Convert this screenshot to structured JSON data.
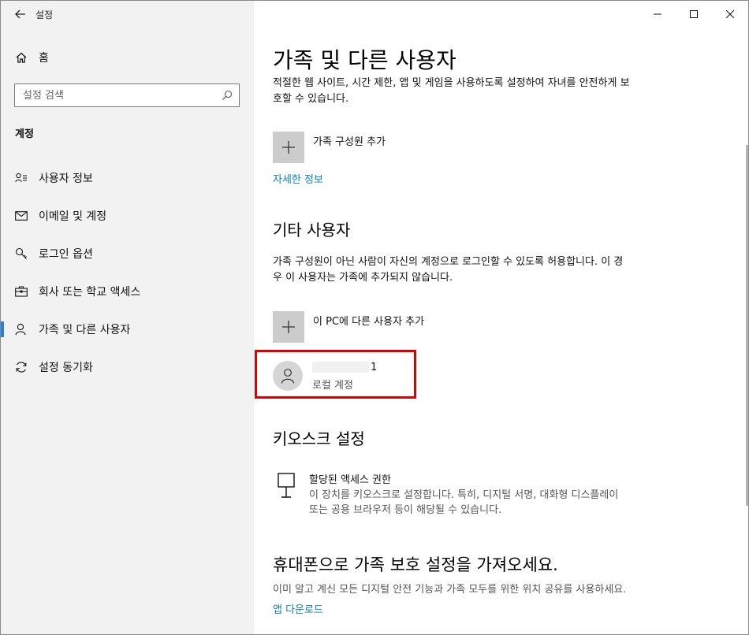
{
  "window": {
    "title": "설정",
    "controls": {
      "minimize": "—",
      "maximize": "☐",
      "close": "✕"
    }
  },
  "sidebar": {
    "home_label": "홈",
    "search_placeholder": "설정 검색",
    "section_label": "계정",
    "items": [
      {
        "label": "사용자 정보",
        "icon": "user-info-icon"
      },
      {
        "label": "이메일 및 계정",
        "icon": "mail-icon"
      },
      {
        "label": "로그인 옵션",
        "icon": "key-icon"
      },
      {
        "label": "회사 또는 학교 액세스",
        "icon": "briefcase-icon"
      },
      {
        "label": "가족 및 다른 사용자",
        "icon": "person-icon",
        "active": true
      },
      {
        "label": "설정 동기화",
        "icon": "sync-icon"
      }
    ]
  },
  "main": {
    "title": "가족 및 다른 사용자",
    "family_desc": "적절한 웹 사이트, 시간 제한, 앱 및 게임을 사용하도록 설정하여 자녀를 안전하게 보호할 수 있습니다.",
    "add_family_label": "가족 구성원 추가",
    "more_info_link": "자세한 정보",
    "other_users_heading": "기타 사용자",
    "other_users_desc": "가족 구성원이 아닌 사람이 자신의 계정으로 로그인할 수 있도록 허용합니다. 이 경우 이 사용자는 가족에 추가되지 않습니다.",
    "add_other_label": "이 PC에 다른 사용자 추가",
    "user": {
      "name_suffix": "1",
      "type": "로컬 계정"
    },
    "kiosk_heading": "키오스크 설정",
    "kiosk_title": "할당된 액세스 권한",
    "kiosk_desc": "이 장치를 키오스크로 설정합니다. 특히, 디지털 서명, 대화형 디스플레이 또는 공용 브라우저 등이 해당될 수 있습니다.",
    "phone_heading": "휴대폰으로 가족 보호 설정을 가져오세요.",
    "phone_desc": "이미 알고 계신 모든 디지털 안전 기능과 가족 모두를 위한 위치 공유를 사용하세요.",
    "app_download_link": "앱 다운로드"
  },
  "colors": {
    "accent": "#0a7fc0",
    "active_indicator": "#2b7fd8",
    "highlight_box": "#e10000"
  }
}
